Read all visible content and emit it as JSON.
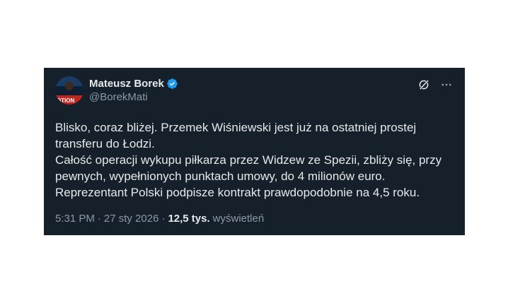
{
  "tweet": {
    "author": {
      "display_name": "Mateusz Borek",
      "handle": "@BorekMati",
      "verified": true,
      "avatar_text": "OTION",
      "verified_icon": "verified-badge-icon"
    },
    "actions": {
      "grok_icon": "grok-icon",
      "more_icon": "more-icon"
    },
    "text": "Blisko, coraz bliżej. Przemek Wiśniewski jest już na ostatniej prostej\ntransferu do Łodzi.\nCałość operacji wykupu piłkarza przez Widzew ze Spezii, zbliży się, przy\npewnych, wypełnionych punktach umowy, do 4 milionów euro.\nReprezentant Polski podpisze kontrakt prawdopodobnie na 4,5 roku.",
    "meta": {
      "time": "5:31 PM",
      "separator": "·",
      "date": "27 sty 2026",
      "views_count": "12,5 tys.",
      "views_label": "wyświetleń"
    }
  },
  "colors": {
    "card_background": "#15202b",
    "text_primary": "#e7e9ea",
    "text_secondary": "#8b98a5",
    "verified_blue": "#1d9bf0"
  }
}
